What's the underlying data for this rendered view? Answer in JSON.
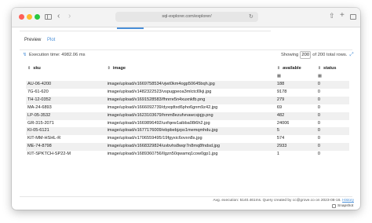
{
  "browser": {
    "url": "sql-explorer.com/explorer/"
  },
  "view_tabs": {
    "preview": "Preview",
    "plot": "Plot"
  },
  "execution": {
    "text": "Execution time: 4982.06 ms"
  },
  "showing": {
    "prefix": "Showing",
    "rows_value": "200",
    "suffix": "of 200 total rows."
  },
  "table": {
    "columns": [
      "sku",
      "image",
      "available",
      "status"
    ],
    "rows": [
      [
        "AU-06-4200",
        "image/upload/v1669758534/vjwt0km4ogp50645bqh.jpg",
        "188",
        "0"
      ],
      [
        "7G-61-620",
        "image/upload/v1482322523/vspugpeoa3mlctcl0kji.jpg",
        "9178",
        "0"
      ],
      [
        "TH-12-0352",
        "image/upload/v1691528583/fhnrre5n4xuxnkfb.png",
        "279",
        "0"
      ],
      [
        "MA-24-6893",
        "image/upload/v1666092739/dyxqdtxd6pho6gnm9z42.jpg",
        "69",
        "0"
      ],
      [
        "LP-05-3532",
        "image/upload/v1623103679/hmm8ezufvnawcsjqjp.png",
        "482",
        "0"
      ],
      [
        "GR-315-2071",
        "image/upload/v1669896492/uxfqew1aibba08i6h2.jpg",
        "24006",
        "0"
      ],
      [
        "KI-05-6121",
        "image/upload/v1677176009/ebpbebjzps1memqmhdu.jpg",
        "5",
        "0"
      ],
      [
        "KIT-MM-HSHL-R",
        "image/upload/v1706559495/19fgyxic6ovxn8s.jpg",
        "574",
        "0"
      ],
      [
        "ME-74-8798",
        "image/upload/v1668329824/uvbvhs8wqr7n8mq8fndsd.jpg",
        "2933",
        "0"
      ],
      [
        "KIT-SPKTCH-SP22-M",
        "image/upload/v1689360756/llgzn50qwamq1cow0gp1.jpg",
        "1",
        "0"
      ]
    ]
  },
  "footer": {
    "text": "Avg. execution: 5140.461ms. Query created by cc@grove.co on 2023-08-16.",
    "history": "History",
    "snapshot": "Snapshot"
  }
}
